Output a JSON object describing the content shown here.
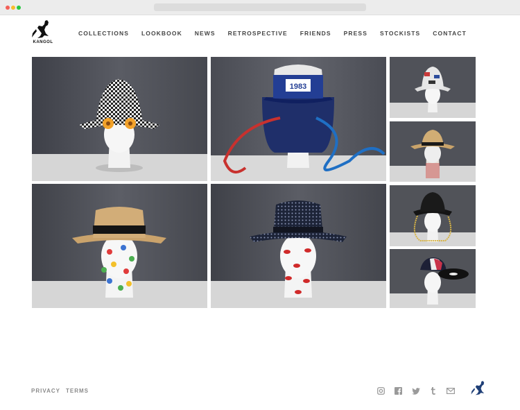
{
  "brand": {
    "logo_text": "KANGOL"
  },
  "nav": {
    "items": [
      {
        "label": "COLLECTIONS"
      },
      {
        "label": "LOOKBOOK"
      },
      {
        "label": "NEWS"
      },
      {
        "label": "RETROSPECTIVE"
      },
      {
        "label": "FRIENDS"
      },
      {
        "label": "PRESS"
      },
      {
        "label": "STOCKISTS"
      },
      {
        "label": "CONTACT"
      }
    ]
  },
  "gallery": {
    "items": [
      {
        "icon": "checkered-bucket-hat-photo"
      },
      {
        "icon": "blue-1983-cap-photo",
        "cap_label": "1983"
      },
      {
        "icon": "printed-bucket-hat-photo"
      },
      {
        "icon": "straw-fedora-photo"
      },
      {
        "icon": "straw-boater-polka-dot-photo"
      },
      {
        "icon": "lips-print-fedora-photo"
      },
      {
        "icon": "black-bucket-hat-chain-photo"
      },
      {
        "icon": "vinyl-cap-photo"
      }
    ]
  },
  "footer": {
    "privacy_label": "PRIVACY",
    "terms_label": "TERMS",
    "social_icons": [
      "instagram-icon",
      "facebook-icon",
      "twitter-icon",
      "tumblr-icon",
      "email-icon"
    ],
    "accent_color": "#1f3f77"
  },
  "colors": {
    "nav_text": "#444444",
    "footer_text": "#8a8a8a",
    "photo_bg": "#4d4f57"
  }
}
